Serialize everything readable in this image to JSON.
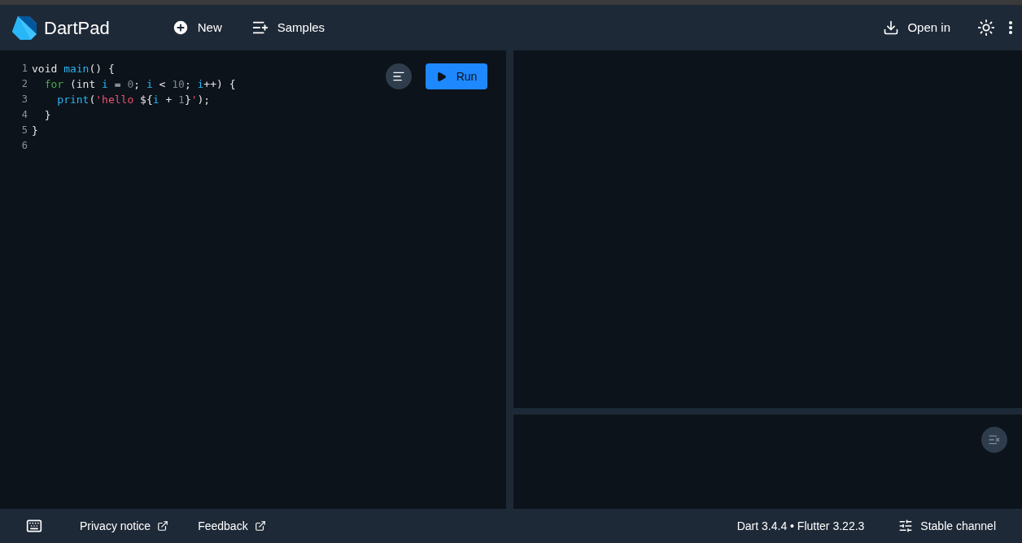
{
  "app": {
    "title": "DartPad"
  },
  "toolbar": {
    "left": [
      {
        "kind": "new",
        "label": "New"
      },
      {
        "kind": "samples",
        "label": "Samples"
      }
    ],
    "open_in": "Open in"
  },
  "editor": {
    "run_button": "Run",
    "lines": [
      {
        "number": "1",
        "tokens": [
          {
            "kind": "plain",
            "text": "void "
          },
          {
            "kind": "fn",
            "text": "main"
          },
          {
            "kind": "plain",
            "text": "() {"
          }
        ]
      },
      {
        "number": "2",
        "tokens": [
          {
            "kind": "keyword",
            "text": "  for"
          },
          {
            "kind": "plain",
            "text": " (int "
          },
          {
            "kind": "var",
            "text": "i"
          },
          {
            "kind": "plain",
            "text": " = "
          },
          {
            "kind": "num",
            "text": "0"
          },
          {
            "kind": "plain",
            "text": "; "
          },
          {
            "kind": "var",
            "text": "i"
          },
          {
            "kind": "plain",
            "text": " < "
          },
          {
            "kind": "num",
            "text": "10"
          },
          {
            "kind": "plain",
            "text": "; "
          },
          {
            "kind": "var",
            "text": "i"
          },
          {
            "kind": "plain",
            "text": "++) {"
          }
        ]
      },
      {
        "number": "3",
        "tokens": [
          {
            "kind": "fn",
            "text": "    print"
          },
          {
            "kind": "plain",
            "text": "("
          },
          {
            "kind": "str",
            "text": "'hello "
          },
          {
            "kind": "plain",
            "text": "${"
          },
          {
            "kind": "var",
            "text": "i"
          },
          {
            "kind": "plain",
            "text": " + "
          },
          {
            "kind": "num",
            "text": "1"
          },
          {
            "kind": "plain",
            "text": "}"
          },
          {
            "kind": "str",
            "text": "'"
          },
          {
            "kind": "plain",
            "text": ");"
          }
        ]
      },
      {
        "number": "4",
        "tokens": [
          {
            "kind": "plain",
            "text": "  }"
          }
        ]
      },
      {
        "number": "5",
        "tokens": [
          {
            "kind": "plain",
            "text": "}"
          }
        ]
      },
      {
        "number": "6"
      }
    ]
  },
  "footer": {
    "links": [
      "Privacy notice",
      "Feedback"
    ],
    "version": "Dart 3.4.4 • Flutter 3.22.3",
    "channel": "Stable channel"
  }
}
